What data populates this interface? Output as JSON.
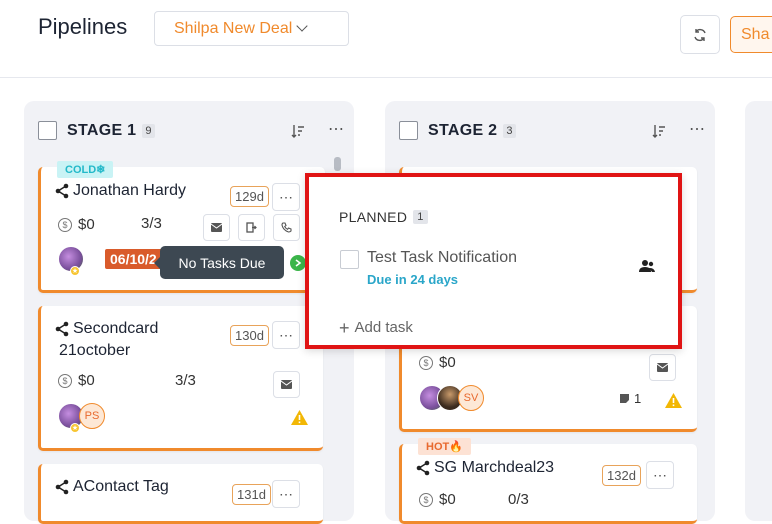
{
  "header": {
    "title": "Pipelines",
    "pipeline_selected": "Shilpa New Deal",
    "share_label": "Sha"
  },
  "columns": [
    {
      "title": "STAGE 1",
      "count": "9"
    },
    {
      "title": "STAGE 2",
      "count": "3"
    }
  ],
  "stage1_cards": [
    {
      "tag": "COLD",
      "name": "Jonathan Hardy",
      "age": "129d",
      "amount": "$0",
      "progress": "3/3",
      "date": "06/10/2"
    },
    {
      "name_line1": "Secondcard",
      "name_line2": "21october",
      "age": "130d",
      "amount": "$0",
      "progress": "3/3",
      "initials": "PS"
    },
    {
      "name": "AContact Tag",
      "age": "131d"
    }
  ],
  "stage2_cards": [
    {
      "amount": "$0",
      "initials": "SV",
      "notes": "1"
    },
    {
      "tag": "HOT",
      "name": "SG Marchdeal23",
      "age": "132d",
      "amount": "$0",
      "progress": "0/3"
    }
  ],
  "tooltip": "No Tasks Due",
  "popup": {
    "heading": "PLANNED",
    "count": "1",
    "task_name": "Test Task Notification",
    "task_due": "Due in 24 days",
    "add_task": "Add task"
  },
  "colors": {
    "accent": "#f08a2c",
    "cold": "#23b9c9",
    "hot": "#e8692e",
    "due": "#2aa6c9",
    "highlight": "#e01414"
  }
}
